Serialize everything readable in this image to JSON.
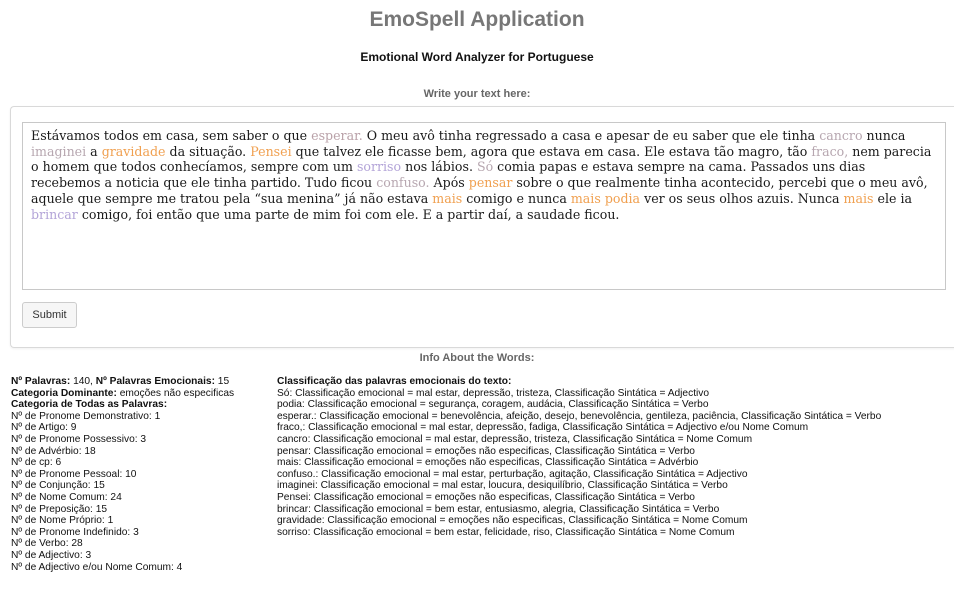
{
  "app": {
    "title": "EmoSpell Application",
    "subtitle": "Emotional Word Analyzer for Portuguese",
    "write_label": "Write your text here:",
    "submit_label": "Submit",
    "info_label": "Info About the Words:"
  },
  "colors": {
    "emotion_gray": "#b7a7b0",
    "emotion_orange": "#f0a050",
    "emotion_purple": "#b3a4d8"
  },
  "text_segments": [
    {
      "t": "Estávamos todos em casa, sem saber o que ",
      "c": ""
    },
    {
      "t": "esperar.",
      "c": "w-pinkgray"
    },
    {
      "t": " O meu avô tinha regressado a casa e apesar de eu saber que ele tinha ",
      "c": ""
    },
    {
      "t": "cancro",
      "c": "w-gray"
    },
    {
      "t": " nunca ",
      "c": ""
    },
    {
      "t": "imaginei",
      "c": "w-gray"
    },
    {
      "t": " a ",
      "c": ""
    },
    {
      "t": "gravidade",
      "c": "w-orange"
    },
    {
      "t": " da situação. ",
      "c": ""
    },
    {
      "t": "Pensei",
      "c": "w-orange"
    },
    {
      "t": " que talvez ele ficasse bem, agora que estava em casa. Ele estava tão magro, tão ",
      "c": ""
    },
    {
      "t": "fraco,",
      "c": "w-gray"
    },
    {
      "t": " nem parecia o homem que todos conhecíamos, sempre com um ",
      "c": ""
    },
    {
      "t": "sorriso",
      "c": "w-purple"
    },
    {
      "t": " nos lábios. ",
      "c": ""
    },
    {
      "t": "Só",
      "c": "w-gray"
    },
    {
      "t": " comia papas e estava sempre na cama. Passados uns dias recebemos a noticia que ele tinha partido. Tudo ficou ",
      "c": ""
    },
    {
      "t": "confuso.",
      "c": "w-gray"
    },
    {
      "t": " Após ",
      "c": ""
    },
    {
      "t": "pensar",
      "c": "w-orange"
    },
    {
      "t": " sobre o que realmente tinha acontecido, percebi que o meu avô, aquele que sempre me tratou pela “sua menina” já não estava ",
      "c": ""
    },
    {
      "t": "mais",
      "c": "w-orange"
    },
    {
      "t": " comigo e nunca ",
      "c": ""
    },
    {
      "t": "mais",
      "c": "w-orange"
    },
    {
      "t": " ",
      "c": ""
    },
    {
      "t": "podia",
      "c": "w-orange"
    },
    {
      "t": " ver os seus olhos azuis. Nunca ",
      "c": ""
    },
    {
      "t": "mais",
      "c": "w-orange"
    },
    {
      "t": " ele ia ",
      "c": ""
    },
    {
      "t": "brincar",
      "c": "w-purple"
    },
    {
      "t": " comigo, foi então que uma parte de mim foi com ele. E a partir daí, a saudade ficou.",
      "c": ""
    }
  ],
  "stats": {
    "palavras_label": "Nº Palavras:",
    "palavras_value": " 140, ",
    "emocionais_label": "Nº Palavras Emocionais:",
    "emocionais_value": " 15",
    "dominante_label": "Categoria Dominante:",
    "dominante_value": " emoções não especificas",
    "todas_label": "Categoria de Todas as Palavras:",
    "categories": [
      "Nº de Pronome Demonstrativo: 1",
      "Nº de Artigo: 9",
      "Nº de Pronome Possessivo: 3",
      "Nº de Advérbio: 18",
      "Nº de cp: 6",
      "Nº de Pronome Pessoal: 10",
      "Nº de Conjunção: 15",
      "Nº de Nome Comum: 24",
      "Nº de Preposição: 15",
      "Nº de Nome Próprio: 1",
      "Nº de Pronome Indefinido: 3",
      "Nº de Verbo: 28",
      "Nº de Adjectivo: 3",
      "Nº de Adjectivo e/ou Nome Comum: 4"
    ]
  },
  "classification": {
    "heading": "Classificação das palavras emocionais do texto:",
    "lines": [
      "Só: Classificação emocional = mal estar, depressão, tristeza, Classificação Sintática = Adjectivo",
      "podia: Classificação emocional = segurança, coragem, audácia, Classificação Sintática = Verbo",
      "esperar.: Classificação emocional = benevolência, afeição, desejo, benevolência, gentileza, paciência, Classificação Sintática = Verbo",
      "fraco,: Classificação emocional = mal estar, depressão, fadiga, Classificação Sintática = Adjectivo e/ou Nome Comum",
      "cancro: Classificação emocional = mal estar, depressão, tristeza, Classificação Sintática = Nome Comum",
      "pensar: Classificação emocional = emoções não especificas, Classificação Sintática = Verbo",
      "mais: Classificação emocional = emoções não especificas, Classificação Sintática = Advérbio",
      "confuso.: Classificação emocional = mal estar, perturbação, agitação, Classificação Sintática = Adjectivo",
      "imaginei: Classificação emocional = mal estar, loucura, desiquilíbrio, Classificação Sintática = Verbo",
      "Pensei: Classificação emocional = emoções não especificas, Classificação Sintática = Verbo",
      "brincar: Classificação emocional = bem estar, entusiasmo, alegria, Classificação Sintática = Verbo",
      "gravidade: Classificação emocional = emoções não especificas, Classificação Sintática = Nome Comum",
      "sorriso: Classificação emocional = bem estar, felicidade, riso, Classificação Sintática = Nome Comum"
    ]
  }
}
